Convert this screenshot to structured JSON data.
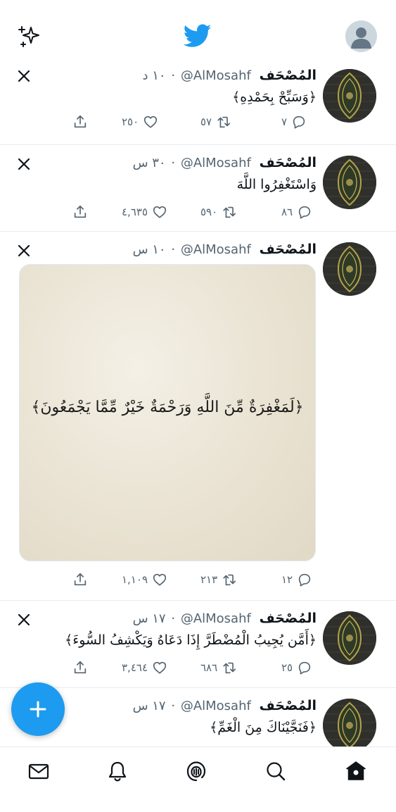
{
  "app": {
    "name": "Twitter",
    "accent": "#1d9bf0"
  },
  "top_bar": {
    "left_icon": "sparkle-icon",
    "center_icon": "twitter-bird-icon",
    "right_icon": "profile-avatar"
  },
  "tweets": [
    {
      "name": "المُصْحَف",
      "handle": "@AlMosahf",
      "sep": "·",
      "time": "١٠ د",
      "text": "﴿وَسَبِّحْ بِحَمْدِهِ﴾",
      "replies": "٧",
      "retweets": "٥٧",
      "likes": "٢٥٠"
    },
    {
      "name": "المُصْحَف",
      "handle": "@AlMosahf",
      "sep": "·",
      "time": "٣٠ س",
      "text": "وَاسْتَغْفِرُوا اللَّهَ",
      "replies": "٨٦",
      "retweets": "٥٩٠",
      "likes": "٤,٦٣٥"
    },
    {
      "name": "المُصْحَف",
      "handle": "@AlMosahf",
      "sep": "·",
      "time": "١٠ س",
      "text": "",
      "media_text": "﴿لَمَغْفِرَةٌ مِّنَ اللَّهِ وَرَحْمَةٌ خَيْرٌ مِّمَّا يَجْمَعُونَ﴾",
      "replies": "١٢",
      "retweets": "٢١٣",
      "likes": "١,١٠٩"
    },
    {
      "name": "المُصْحَف",
      "handle": "@AlMosahf",
      "sep": "·",
      "time": "١٧ س",
      "text": "﴿أَمَّن يُجِيبُ الْمُضْطَرَّ إِذَا دَعَاهُ وَيَكْشِفُ السُّوءَ﴾",
      "replies": "٢٥",
      "retweets": "٦٨٦",
      "likes": "٣,٤٦٤"
    },
    {
      "name": "المُصْحَف",
      "handle": "@AlMosahf",
      "sep": "·",
      "time": "١٧ س",
      "text": "﴿فَنَجَّيْنَاكَ مِنَ الْغَمِّ﴾",
      "replies": "",
      "retweets": "",
      "likes": ""
    }
  ],
  "fab": {
    "icon": "plus-icon"
  },
  "bottom_nav": [
    {
      "id": "messages",
      "icon": "mail-icon"
    },
    {
      "id": "notifications",
      "icon": "bell-icon"
    },
    {
      "id": "spaces",
      "icon": "spaces-icon"
    },
    {
      "id": "search",
      "icon": "search-icon"
    },
    {
      "id": "home",
      "icon": "home-icon",
      "active": true
    }
  ]
}
